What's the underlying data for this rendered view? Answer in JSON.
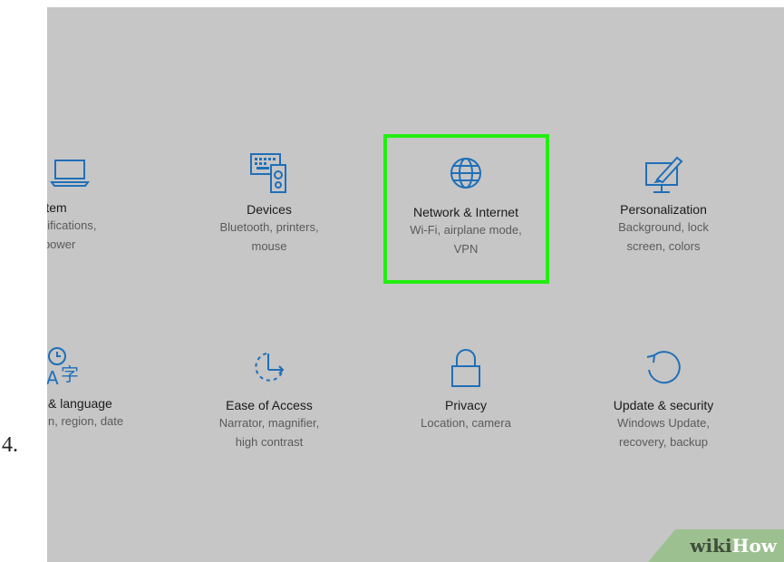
{
  "step_number": "4.",
  "tiles": [
    {
      "name": "system",
      "title": "System",
      "sub1": ", notifications,",
      "sub2": "ps, power",
      "icon": "laptop-icon"
    },
    {
      "name": "devices",
      "title": "Devices",
      "sub1": "Bluetooth, printers,",
      "sub2": "mouse",
      "icon": "devices-icon"
    },
    {
      "name": "network",
      "title": "Network & Internet",
      "sub1": "Wi-Fi, airplane mode,",
      "sub2": "VPN",
      "icon": "globe-icon"
    },
    {
      "name": "personalization",
      "title": "Personalization",
      "sub1": "Background, lock",
      "sub2": "screen, colors",
      "icon": "personalization-icon"
    },
    {
      "name": "time-language",
      "title": "& language",
      "sub1": "n, region, date",
      "sub2": "",
      "icon": "time-language-icon"
    },
    {
      "name": "ease-of-access",
      "title": "Ease of Access",
      "sub1": "Narrator, magnifier,",
      "sub2": "high contrast",
      "icon": "ease-of-access-icon"
    },
    {
      "name": "privacy",
      "title": "Privacy",
      "sub1": "Location, camera",
      "sub2": "",
      "icon": "lock-icon"
    },
    {
      "name": "update-security",
      "title": "Update & security",
      "sub1": "Windows Update,",
      "sub2": "recovery, backup",
      "icon": "refresh-icon"
    }
  ],
  "highlight_color": "#22ee11",
  "icon_color": "#1f6fb8",
  "watermark": {
    "wiki": "wiki",
    "how": "How"
  }
}
